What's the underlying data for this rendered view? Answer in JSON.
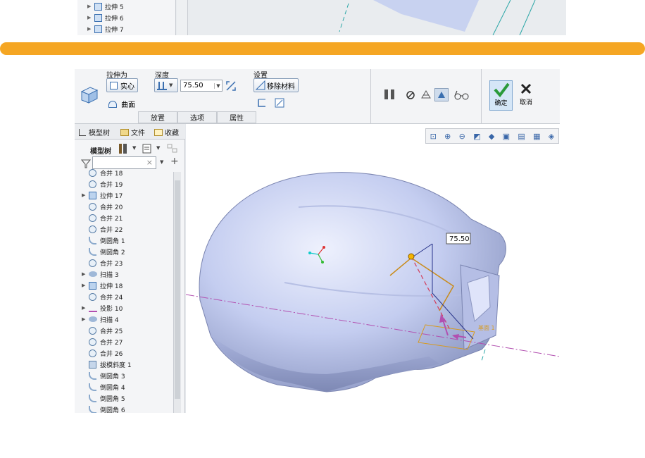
{
  "top_tree": {
    "items": [
      {
        "label": "拉伸 5"
      },
      {
        "label": "拉伸 6"
      },
      {
        "label": "拉伸 7"
      }
    ]
  },
  "ribbon": {
    "extrude_as_label": "拉伸为",
    "solid_label": "实心",
    "surface_label": "曲面",
    "depth_label": "深度",
    "depth_value": "75.50",
    "settings_label": "设置",
    "remove_material_label": "移除材料",
    "confirm_label": "确定",
    "cancel_label": "取消",
    "tabs": [
      "放置",
      "选项",
      "属性"
    ]
  },
  "panel": {
    "tabs": [
      "模型树",
      "文件",
      "收藏"
    ],
    "model_tree_label": "模型树",
    "items": [
      {
        "label": "合并 18",
        "icon": "merge"
      },
      {
        "label": "合并 19",
        "icon": "merge"
      },
      {
        "label": "拉伸 17",
        "icon": "extrude",
        "expandable": true
      },
      {
        "label": "合并 20",
        "icon": "merge"
      },
      {
        "label": "合并 21",
        "icon": "merge"
      },
      {
        "label": "合并 22",
        "icon": "merge"
      },
      {
        "label": "倒圆角 1",
        "icon": "round"
      },
      {
        "label": "倒圆角 2",
        "icon": "round"
      },
      {
        "label": "合并 23",
        "icon": "merge"
      },
      {
        "label": "扫描 3",
        "icon": "sweep",
        "expandable": true
      },
      {
        "label": "拉伸 18",
        "icon": "extrude",
        "expandable": true
      },
      {
        "label": "合并 24",
        "icon": "merge"
      },
      {
        "label": "投影 10",
        "icon": "projection",
        "expandable": true
      },
      {
        "label": "扫描 4",
        "icon": "sweep",
        "expandable": true
      },
      {
        "label": "合并 25",
        "icon": "merge"
      },
      {
        "label": "合并 27",
        "icon": "merge"
      },
      {
        "label": "合并 26",
        "icon": "merge"
      },
      {
        "label": "拔模斜度 1",
        "icon": "draft"
      },
      {
        "label": "倒圆角 3",
        "icon": "round"
      },
      {
        "label": "倒圆角 4",
        "icon": "round"
      },
      {
        "label": "倒圆角 5",
        "icon": "round"
      },
      {
        "label": "倒圆角 6",
        "icon": "round"
      }
    ]
  },
  "viewport": {
    "dimension_value": "75.50",
    "plane_label": "基面 1"
  },
  "colors": {
    "accent_orange": "#f5a623",
    "model_blue": "#c4cdf0",
    "confirm_green": "#2a9a3a"
  }
}
